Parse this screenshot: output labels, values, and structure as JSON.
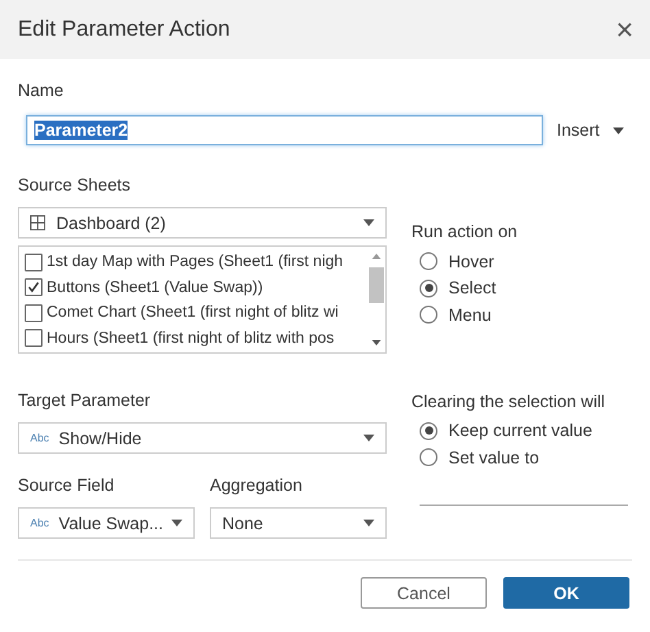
{
  "window": {
    "title": "Edit Parameter Action",
    "close": "×"
  },
  "name": {
    "label": "Name",
    "value": "Parameter2",
    "insert": "Insert"
  },
  "source_sheets": {
    "label": "Source Sheets",
    "dropdown": "Dashboard (2)",
    "items": [
      {
        "label": "1st day Map with Pages (Sheet1 (first nigh",
        "checked": false
      },
      {
        "label": "Buttons (Sheet1 (Value Swap))",
        "checked": true
      },
      {
        "label": "Comet Chart (Sheet1 (first night of blitz wi",
        "checked": false
      },
      {
        "label": "Hours (Sheet1 (first night of blitz with pos",
        "checked": false
      }
    ]
  },
  "run_action": {
    "label": "Run action on",
    "options": [
      {
        "label": "Hover",
        "selected": false
      },
      {
        "label": "Select",
        "selected": true
      },
      {
        "label": "Menu",
        "selected": false
      }
    ]
  },
  "target_parameter": {
    "label": "Target Parameter",
    "type_badge": "Abc",
    "value": "Show/Hide"
  },
  "source_field": {
    "label": "Source Field",
    "type_badge": "Abc",
    "value": "Value Swap..."
  },
  "aggregation": {
    "label": "Aggregation",
    "value": "None"
  },
  "clearing": {
    "label": "Clearing the selection will",
    "options": [
      {
        "label": "Keep current value",
        "selected": true
      },
      {
        "label": "Set value to",
        "selected": false
      }
    ]
  },
  "buttons": {
    "cancel": "Cancel",
    "ok": "OK"
  }
}
